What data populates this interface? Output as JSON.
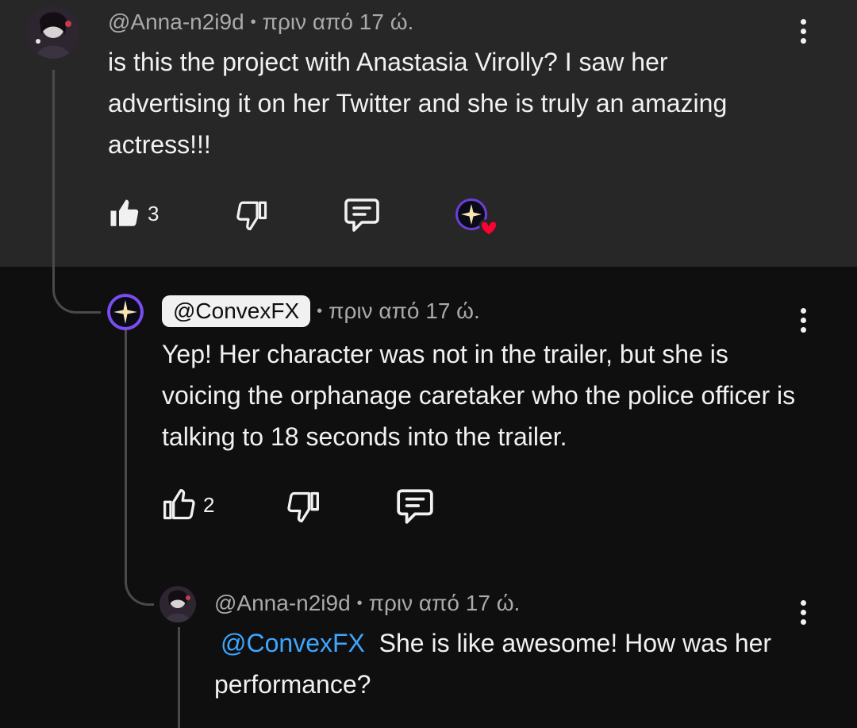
{
  "comments": [
    {
      "author": "@Anna-n2i9d",
      "time": "πριν από 17 ώ.",
      "text": "is this the project with Anastasia Virolly? I saw her advertising it on her Twitter and she is truly an amazing actress!!!",
      "likes": "3",
      "liked": true,
      "creator_heart": true
    },
    {
      "author": "@ConvexFX",
      "time": "πριν από 17 ώ.",
      "text": "Yep! Her character was not in the trailer, but she is voicing the orphanage caretaker who the police officer is talking to 18 seconds into the trailer.",
      "likes": "2",
      "liked": false,
      "is_creator": true
    },
    {
      "author": "@Anna-n2i9d",
      "time": "πριν από 17 ώ.",
      "mention": "@ConvexFX",
      "text": "She is like awesome! How was her performance?"
    }
  ],
  "icons": {
    "like": "thumbs-up-icon",
    "dislike": "thumbs-down-icon",
    "reply": "reply-comment-icon",
    "more": "more-vertical-icon",
    "heart": "creator-heart-icon"
  },
  "colors": {
    "top_band": "#272727",
    "background": "#0f0f0f",
    "mention": "#3ea6ff",
    "heart": "#ff0033"
  }
}
